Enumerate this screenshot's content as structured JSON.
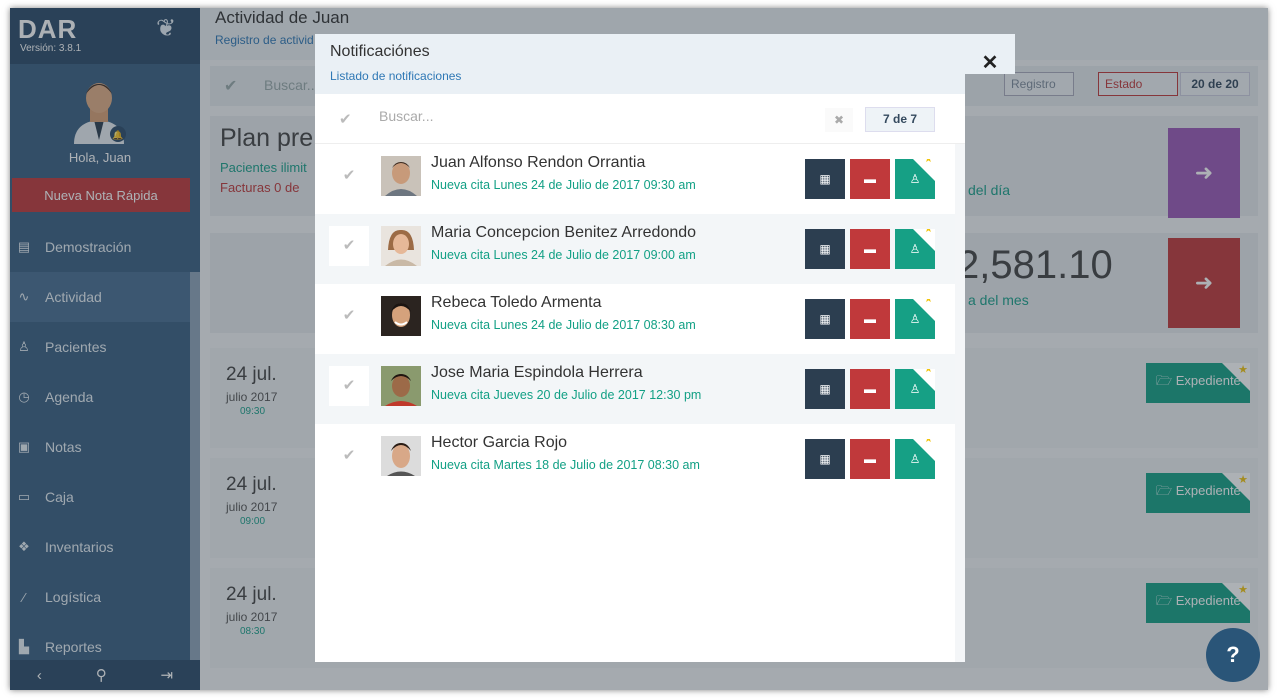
{
  "sidebar": {
    "brand": "DAR",
    "version": "Versión: 3.8.1",
    "greeting": "Hola, Juan",
    "quick_note": "Nueva Nota Rápida",
    "items": [
      {
        "label": "Demostración",
        "icon": "clipboard-icon"
      },
      {
        "label": "Actividad",
        "icon": "pulse-icon"
      },
      {
        "label": "Pacientes",
        "icon": "user-icon"
      },
      {
        "label": "Agenda",
        "icon": "clock-icon"
      },
      {
        "label": "Notas",
        "icon": "notes-icon"
      },
      {
        "label": "Caja",
        "icon": "money-icon"
      },
      {
        "label": "Inventarios",
        "icon": "dropbox-icon"
      },
      {
        "label": "Logística",
        "icon": "magic-wand-icon"
      },
      {
        "label": "Reportes",
        "icon": "file-icon"
      }
    ]
  },
  "page": {
    "title": "Actividad de Juan",
    "subtitle": "Registro de activid",
    "search_placeholder": "Buscar...",
    "filter_registro": "Registro",
    "filter_estado": "Estado",
    "count": "20 de 20",
    "plan_title": "Plan pre",
    "plan_line1": "Pacientes ilimit",
    "plan_line2": "Facturas 0 de",
    "day_label": "del día",
    "amount": "2,581.10",
    "month_label": "a del mes",
    "expediente_label": "Expediente",
    "dates": [
      {
        "day": "24 jul.",
        "month": "julio 2017",
        "time": "09:30"
      },
      {
        "day": "24 jul.",
        "month": "julio 2017",
        "time": "09:00"
      },
      {
        "day": "24 jul.",
        "month": "julio 2017",
        "time": "08:30"
      }
    ]
  },
  "modal": {
    "title": "Notificaciónes",
    "subtitle": "Listado de notificaciones",
    "search_placeholder": "Buscar...",
    "count": "7 de 7",
    "notifications": [
      {
        "name": "Juan Alfonso Rendon Orrantia",
        "desc": "Nueva cita Lunes 24 de Julio de 2017 09:30 am"
      },
      {
        "name": "Maria Concepcion Benitez Arredondo",
        "desc": "Nueva cita Lunes 24 de Julio de 2017 09:00 am"
      },
      {
        "name": "Rebeca Toledo Armenta",
        "desc": "Nueva cita Lunes 24 de Julio de 2017 08:30 am"
      },
      {
        "name": "Jose Maria Espindola Herrera",
        "desc": "Nueva cita Jueves 20 de Julio de 2017 12:30 pm"
      },
      {
        "name": "Hector Garcia Rojo",
        "desc": "Nueva cita Martes 18 de Julio de 2017 08:30 am"
      }
    ]
  },
  "help_label": "?",
  "colors": {
    "sidebar": "#3a5f82",
    "accent_green": "#16a085",
    "accent_red": "#c0393b",
    "dark": "#2c3e50",
    "purple": "#9b59b6"
  }
}
